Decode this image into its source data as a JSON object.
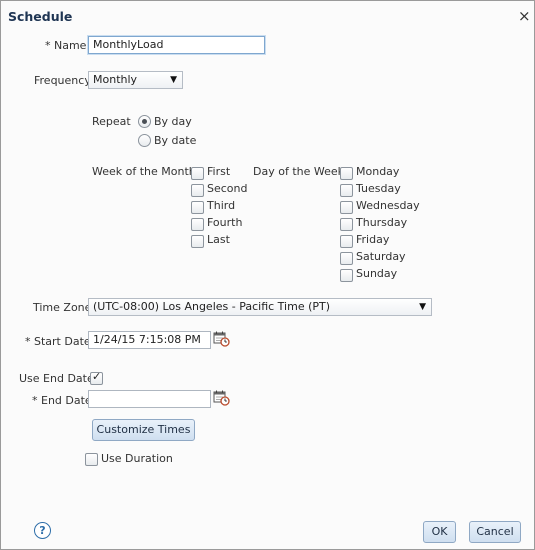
{
  "dialog": {
    "title": "Schedule",
    "close": "×"
  },
  "name": {
    "label": "* Name",
    "value": "MonthlyLoad"
  },
  "frequency": {
    "label": "Frequency",
    "value": "Monthly"
  },
  "repeat": {
    "label": "Repeat",
    "options": [
      "By day",
      "By date"
    ],
    "selected": "By day"
  },
  "week_of_month": {
    "label": "Week of the Month",
    "items": [
      "First",
      "Second",
      "Third",
      "Fourth",
      "Last"
    ]
  },
  "day_of_week": {
    "label": "Day of the Week",
    "items": [
      "Monday",
      "Tuesday",
      "Wednesday",
      "Thursday",
      "Friday",
      "Saturday",
      "Sunday"
    ]
  },
  "time_zone": {
    "label": "Time Zone",
    "value": "(UTC-08:00) Los Angeles - Pacific Time (PT)"
  },
  "start_date": {
    "label": "* Start Date",
    "value": "1/24/15 7:15:08 PM"
  },
  "use_end_date": {
    "label": "Use End Date",
    "checked": true
  },
  "end_date": {
    "label": "* End Date",
    "value": ""
  },
  "customize_times": {
    "label": "Customize Times"
  },
  "use_duration": {
    "label": "Use Duration",
    "checked": false
  },
  "footer": {
    "ok": "OK",
    "cancel": "Cancel",
    "help": "?"
  },
  "colors": {
    "title": "#1f3553",
    "button_top": "#e9f1fa",
    "button_bottom": "#cfdff0",
    "help": "#2e6ea9"
  }
}
